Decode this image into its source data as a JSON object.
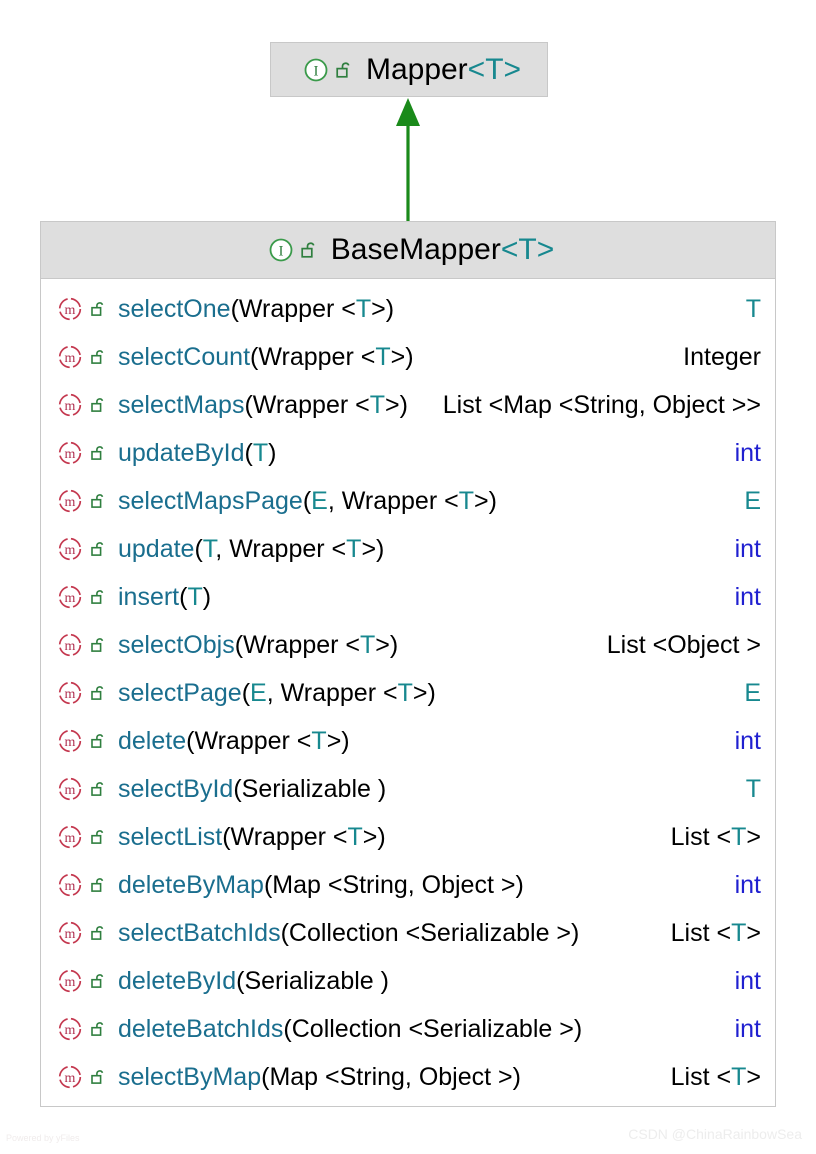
{
  "diagram": {
    "type": "uml-class-diagram",
    "relationship": "generalization-realization",
    "arrow_color": "#1a8a1a"
  },
  "super_type": {
    "name": "Mapper",
    "generic": "<T>",
    "stereotype_icon": "interface-icon",
    "visibility_icon": "unlock-icon"
  },
  "sub_type": {
    "name": "BaseMapper",
    "generic": "<T>",
    "stereotype_icon": "interface-icon",
    "visibility_icon": "unlock-icon"
  },
  "methods": [
    {
      "icon": "method-icon",
      "lock": "unlock-icon",
      "name": "selectOne",
      "params": "(Wrapper <T>)",
      "ret": "T",
      "ret_kind": "generic"
    },
    {
      "icon": "method-icon",
      "lock": "unlock-icon",
      "name": "selectCount",
      "params": "(Wrapper <T>)",
      "ret": "Integer",
      "ret_kind": "object"
    },
    {
      "icon": "method-icon",
      "lock": "unlock-icon",
      "name": "selectMaps",
      "params": "(Wrapper <T>)",
      "ret": "List <Map <String, Object >>",
      "ret_kind": "object"
    },
    {
      "icon": "method-icon",
      "lock": "unlock-icon",
      "name": "updateById",
      "params": "(T)",
      "ret": "int",
      "ret_kind": "primitive"
    },
    {
      "icon": "method-icon",
      "lock": "unlock-icon",
      "name": "selectMapsPage",
      "params": "(E, Wrapper <T>)",
      "ret": "E",
      "ret_kind": "generic"
    },
    {
      "icon": "method-icon",
      "lock": "unlock-icon",
      "name": "update",
      "params": "(T, Wrapper <T>)",
      "ret": "int",
      "ret_kind": "primitive"
    },
    {
      "icon": "method-icon",
      "lock": "unlock-icon",
      "name": "insert",
      "params": "(T)",
      "ret": "int",
      "ret_kind": "primitive"
    },
    {
      "icon": "method-icon",
      "lock": "unlock-icon",
      "name": "selectObjs",
      "params": "(Wrapper <T>)",
      "ret": "List <Object >",
      "ret_kind": "object"
    },
    {
      "icon": "method-icon",
      "lock": "unlock-icon",
      "name": "selectPage",
      "params": "(E, Wrapper <T>)",
      "ret": "E",
      "ret_kind": "generic"
    },
    {
      "icon": "method-icon",
      "lock": "unlock-icon",
      "name": "delete",
      "params": "(Wrapper <T>)",
      "ret": "int",
      "ret_kind": "primitive"
    },
    {
      "icon": "method-icon",
      "lock": "unlock-icon",
      "name": "selectById",
      "params": "(Serializable )",
      "ret": "T",
      "ret_kind": "generic"
    },
    {
      "icon": "method-icon",
      "lock": "unlock-icon",
      "name": "selectList",
      "params": "(Wrapper <T>)",
      "ret": "List <T>",
      "ret_kind": "object-generic"
    },
    {
      "icon": "method-icon",
      "lock": "unlock-icon",
      "name": "deleteByMap",
      "params": "(Map <String, Object >)",
      "ret": "int",
      "ret_kind": "primitive"
    },
    {
      "icon": "method-icon",
      "lock": "unlock-icon",
      "name": "selectBatchIds",
      "params": "(Collection <Serializable >)",
      "ret": "List <T>",
      "ret_kind": "object-generic"
    },
    {
      "icon": "method-icon",
      "lock": "unlock-icon",
      "name": "deleteById",
      "params": "(Serializable )",
      "ret": "int",
      "ret_kind": "primitive"
    },
    {
      "icon": "method-icon",
      "lock": "unlock-icon",
      "name": "deleteBatchIds",
      "params": "(Collection <Serializable >)",
      "ret": "int",
      "ret_kind": "primitive"
    },
    {
      "icon": "method-icon",
      "lock": "unlock-icon",
      "name": "selectByMap",
      "params": "(Map <String, Object >)",
      "ret": "List <T>",
      "ret_kind": "object-generic"
    }
  ],
  "watermarks": {
    "yfiles": "Powered by yFiles",
    "csdn": "CSDN @ChinaRainbowSea"
  },
  "colors": {
    "header_bg": "#dedede",
    "border": "#c8c8c8",
    "method_name": "#1a6e8e",
    "generic_type": "#17888f",
    "primitive": "#2020d0",
    "interface_icon": "#3a9a4a",
    "method_icon": "#c4384f",
    "arrow": "#1a8a1a"
  }
}
